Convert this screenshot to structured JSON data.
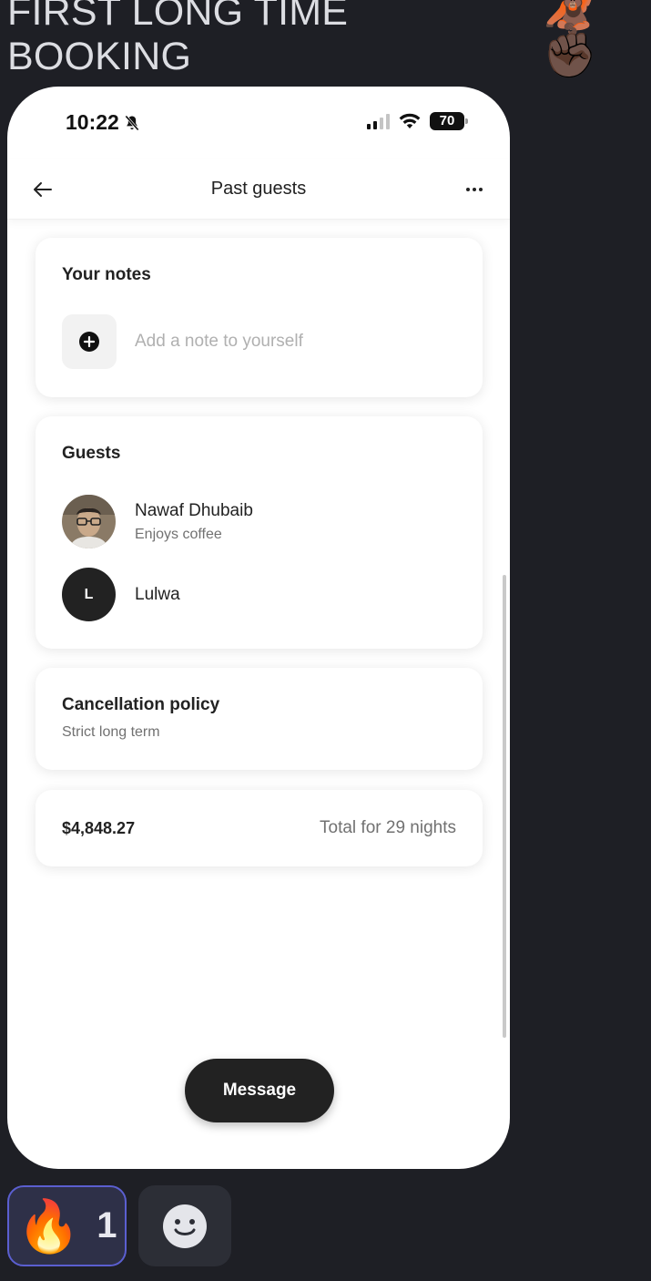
{
  "chat": {
    "title": "FIRST LONG TIME BOOKING",
    "title_emojis": "🦧✊🏿"
  },
  "status_bar": {
    "time": "10:22",
    "battery": "70"
  },
  "nav": {
    "title": "Past guests"
  },
  "notes": {
    "title": "Your notes",
    "placeholder": "Add a note to yourself"
  },
  "guests": {
    "title": "Guests",
    "list": [
      {
        "name": "Nawaf Dhubaib",
        "subtitle": "Enjoys coffee"
      },
      {
        "name": "Lulwa",
        "initial": "L"
      }
    ]
  },
  "cancellation": {
    "title": "Cancellation policy",
    "value": "Strict long term"
  },
  "total": {
    "amount": "$4,848.27",
    "label": "Total for 29 nights"
  },
  "message_button": {
    "label": "Message"
  },
  "reaction": {
    "emoji": "🔥",
    "count": "1"
  },
  "colors": {
    "background": "#1e1f25",
    "accent_border": "#5b5fd0",
    "primary_dark": "#222222",
    "muted_text": "#717171"
  }
}
